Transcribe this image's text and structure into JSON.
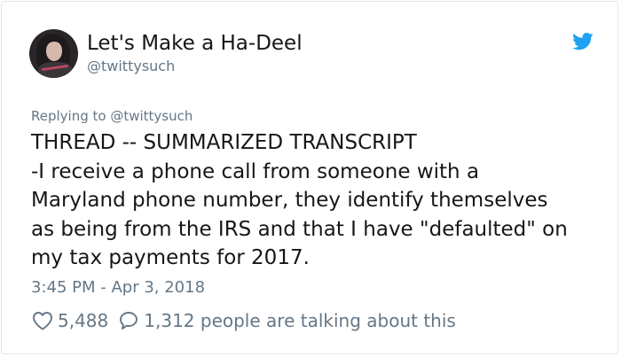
{
  "header": {
    "display_name": "Let's Make a Ha-Deel",
    "handle": "@twittysuch"
  },
  "tweet": {
    "replying_to": "Replying to @twittysuch",
    "lines": [
      "THREAD -- SUMMARIZED TRANSCRIPT",
      "-I receive a phone call from someone with a",
      "Maryland phone number, they identify themselves",
      "as being from the IRS and that I have \"defaulted\" on",
      "my tax payments for 2017."
    ],
    "timestamp": "3:45 PM - Apr 3, 2018"
  },
  "actions": {
    "likes": "5,488",
    "talking": "1,312 people are talking about this"
  },
  "icons": {
    "brand": "twitter-bird-icon",
    "like": "heart-icon",
    "reply": "comment-bubble-icon"
  },
  "colors": {
    "twitter_blue": "#1da1f2",
    "muted_text": "#657786",
    "primary_text": "#14171a",
    "border": "#e1e8ed"
  }
}
